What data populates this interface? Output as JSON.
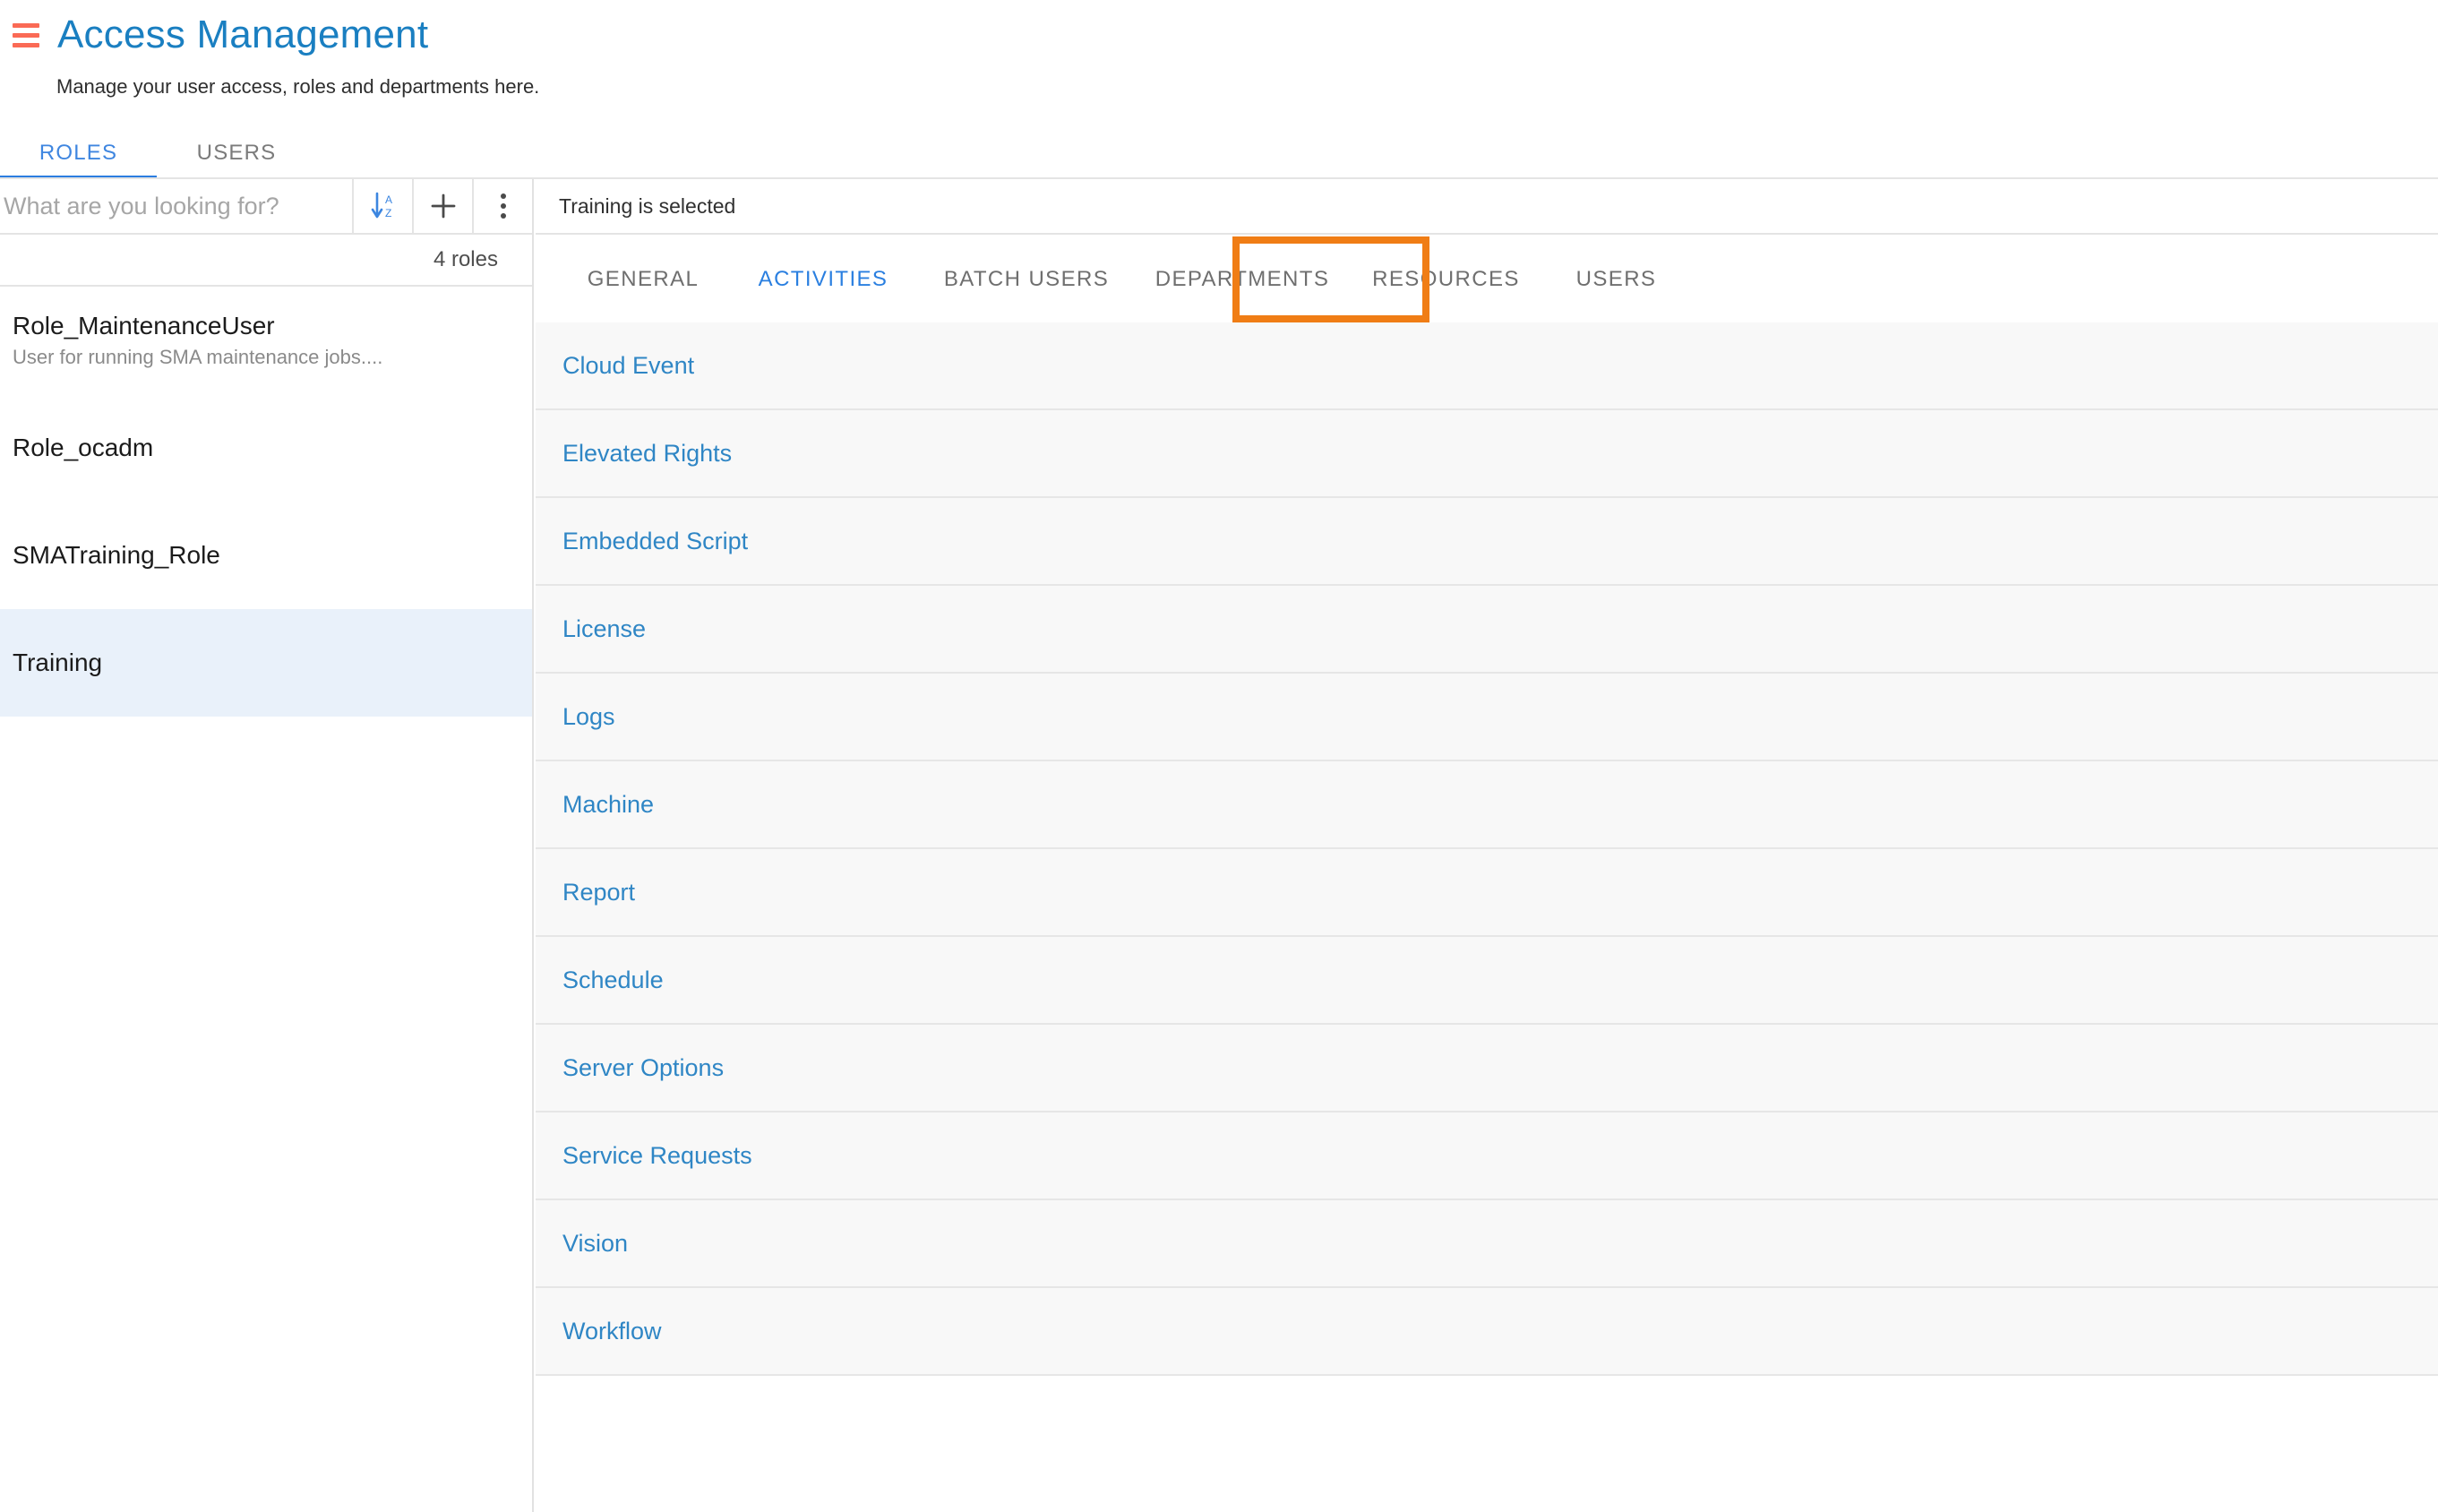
{
  "header": {
    "menu_icon": "hamburger-icon",
    "title": "Access Management",
    "subtitle": "Manage your user access, roles and departments here."
  },
  "top_tabs": [
    {
      "label": "ROLES",
      "active": true
    },
    {
      "label": "USERS",
      "active": false
    }
  ],
  "left_panel": {
    "search": {
      "placeholder": "What are you looking for?",
      "value": ""
    },
    "toolbar_buttons": [
      {
        "name": "sort-az-icon",
        "label": "Sort A-Z"
      },
      {
        "name": "add-icon",
        "label": "Add"
      },
      {
        "name": "more-options-icon",
        "label": "More options"
      }
    ],
    "count_label": "4 roles",
    "roles": [
      {
        "name": "Role_MaintenanceUser",
        "description": "User for running SMA maintenance jobs....",
        "selected": false
      },
      {
        "name": "Role_ocadm",
        "description": "",
        "selected": false
      },
      {
        "name": "SMATraining_Role",
        "description": "",
        "selected": false
      },
      {
        "name": "Training",
        "description": "",
        "selected": true
      }
    ]
  },
  "right_panel": {
    "selection_status": "Training is selected",
    "detail_tabs": [
      {
        "label": "GENERAL",
        "active": false
      },
      {
        "label": "ACTIVITIES",
        "active": true
      },
      {
        "label": "BATCH USERS",
        "active": false
      },
      {
        "label": "DEPARTMENTS",
        "active": false
      },
      {
        "label": "RESOURCES",
        "active": false
      },
      {
        "label": "USERS",
        "active": false
      }
    ],
    "activities": [
      "Cloud Event",
      "Elevated Rights",
      "Embedded Script",
      "License",
      "Logs",
      "Machine",
      "Report",
      "Schedule",
      "Server Options",
      "Service Requests",
      "Vision",
      "Workflow"
    ]
  },
  "colors": {
    "title_blue": "#1a7fc1",
    "link_blue": "#2f86c5",
    "active_tab_blue": "#2a7fe0",
    "hamburger_red": "#fa6a55",
    "highlight_orange": "#f07d15",
    "selected_row_bg": "#e9f1fa",
    "row_bg": "#f8f8f8"
  }
}
